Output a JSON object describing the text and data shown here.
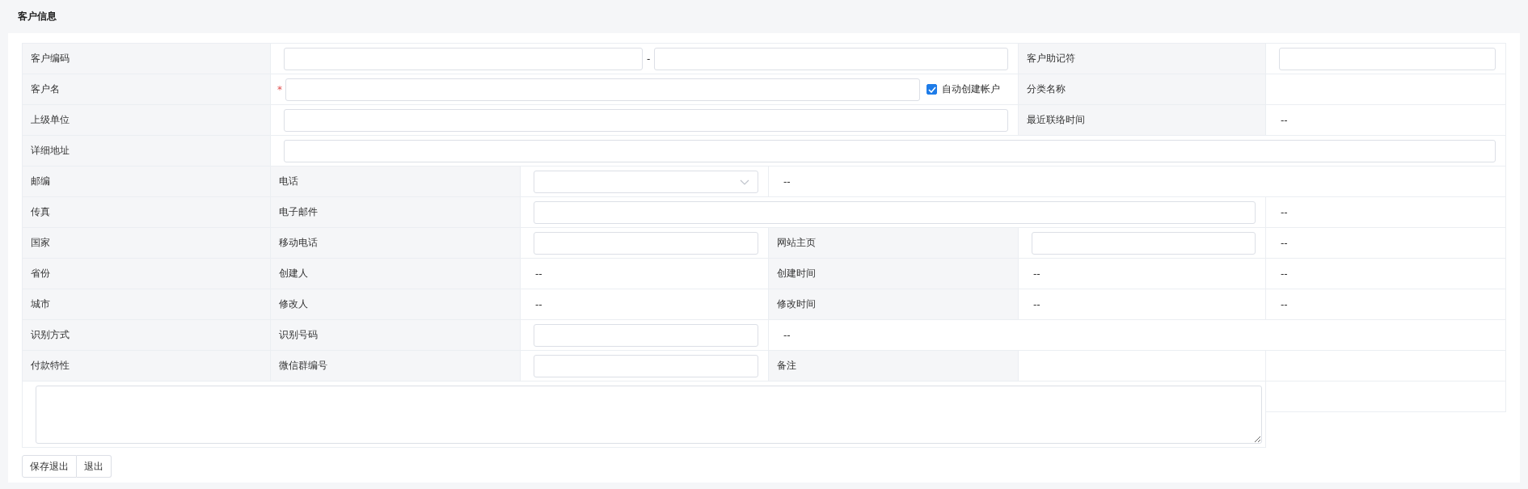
{
  "title": "客户信息",
  "rows": [
    [
      {
        "kind": "label",
        "text": "客户编码"
      },
      {
        "kind": "code_pair",
        "separator": "-"
      },
      {
        "kind": "label",
        "text": "客户助记符"
      },
      {
        "kind": "input"
      }
    ],
    [
      {
        "kind": "label",
        "text": "客户名"
      },
      {
        "kind": "name_input",
        "required_mark": "*",
        "checkbox": {
          "label": "自动创建帐户",
          "checked": true
        }
      },
      {
        "kind": "label",
        "text": "分类名称"
      },
      {
        "kind": "empty"
      }
    ],
    [
      {
        "kind": "label",
        "text": "上级单位"
      },
      {
        "kind": "input"
      },
      {
        "kind": "label",
        "text": "最近联络时间"
      },
      {
        "kind": "text",
        "text": "--"
      }
    ],
    [
      {
        "kind": "label",
        "text": "详细地址"
      },
      {
        "kind": "input"
      }
    ],
    [
      {
        "kind": "label",
        "text": "邮编"
      },
      {
        "kind": "label",
        "text": "电话"
      },
      {
        "kind": "select"
      },
      {
        "kind": "text",
        "text": "--"
      }
    ],
    [
      {
        "kind": "label",
        "text": "传真"
      },
      {
        "kind": "label",
        "text": "电子邮件"
      },
      {
        "kind": "input"
      },
      {
        "kind": "text",
        "text": "--"
      }
    ],
    [
      {
        "kind": "label",
        "text": "国家"
      },
      {
        "kind": "label",
        "text": "移动电话"
      },
      {
        "kind": "input"
      },
      {
        "kind": "label",
        "text": "网站主页"
      },
      {
        "kind": "input"
      },
      {
        "kind": "text",
        "text": "--"
      }
    ],
    [
      {
        "kind": "label",
        "text": "省份"
      },
      {
        "kind": "label",
        "text": "创建人"
      },
      {
        "kind": "text",
        "text": "--"
      },
      {
        "kind": "label",
        "text": "创建时间"
      },
      {
        "kind": "text",
        "text": "--"
      },
      {
        "kind": "text",
        "text": "--"
      }
    ],
    [
      {
        "kind": "label",
        "text": "城市"
      },
      {
        "kind": "label",
        "text": "修改人"
      },
      {
        "kind": "text",
        "text": "--"
      },
      {
        "kind": "label",
        "text": "修改时间"
      },
      {
        "kind": "text",
        "text": "--"
      },
      {
        "kind": "text",
        "text": "--"
      }
    ],
    [
      {
        "kind": "label",
        "text": "识别方式"
      },
      {
        "kind": "label",
        "text": "识别号码"
      },
      {
        "kind": "input"
      },
      {
        "kind": "text",
        "text": "--"
      }
    ],
    [
      {
        "kind": "label",
        "text": "付款特性"
      },
      {
        "kind": "label",
        "text": "微信群编号"
      },
      {
        "kind": "input"
      },
      {
        "kind": "label",
        "text": "备注"
      },
      {
        "kind": "empty"
      },
      {
        "kind": "empty"
      }
    ],
    [
      {
        "kind": "textarea"
      },
      {
        "kind": "empty"
      }
    ]
  ],
  "buttons": [
    "保存退出",
    "退出"
  ]
}
